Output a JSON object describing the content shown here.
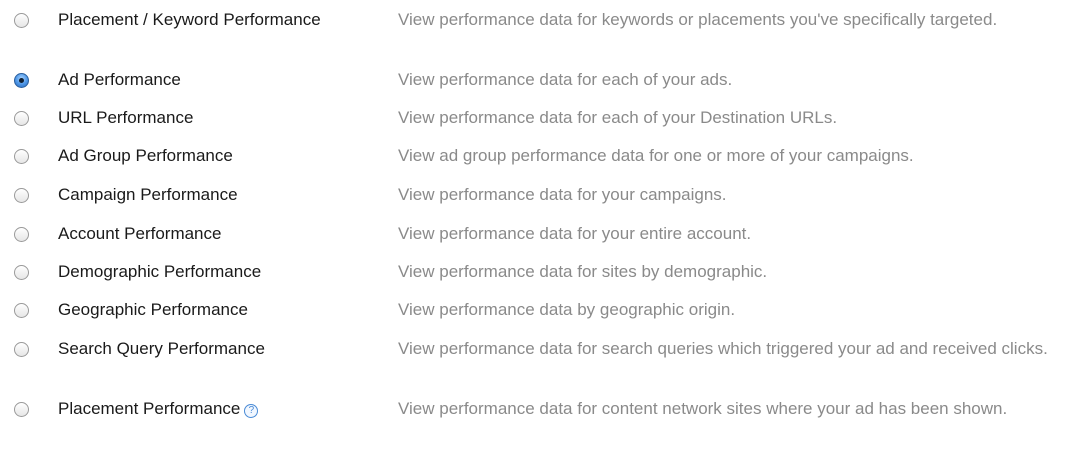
{
  "reports": [
    {
      "label": "Placement / Keyword Performance",
      "description": "View performance data for keywords or placements you've specifically targeted.",
      "selected": false
    },
    {
      "label": "Ad Performance",
      "description": "View performance data for each of your ads.",
      "selected": true
    },
    {
      "label": "URL Performance",
      "description": "View performance data for each of your Destination URLs.",
      "selected": false
    },
    {
      "label": "Ad Group Performance",
      "description": "View ad group performance data for one or more of your campaigns.",
      "selected": false
    },
    {
      "label": "Campaign Performance",
      "description": "View performance data for your campaigns.",
      "selected": false
    },
    {
      "label": "Account Performance",
      "description": "View performance data for your entire account.",
      "selected": false
    },
    {
      "label": "Demographic Performance",
      "description": "View performance data for sites by demographic.",
      "selected": false
    },
    {
      "label": "Geographic Performance",
      "description": "View performance data by geographic origin.",
      "selected": false
    },
    {
      "label": "Search Query Performance",
      "description": "View performance data for search queries which triggered your ad and received clicks.",
      "selected": false
    },
    {
      "label": "Placement Performance",
      "description": "View performance data for content network sites where your ad has been shown.",
      "selected": false,
      "help_icon": "question-mark",
      "help_glyph": "?"
    }
  ],
  "colors": {
    "label_text": "#1a1a1a",
    "description_text": "#8a8a8a",
    "radio_selected": "#4c95e6",
    "help_icon": "#4a8bd6"
  }
}
